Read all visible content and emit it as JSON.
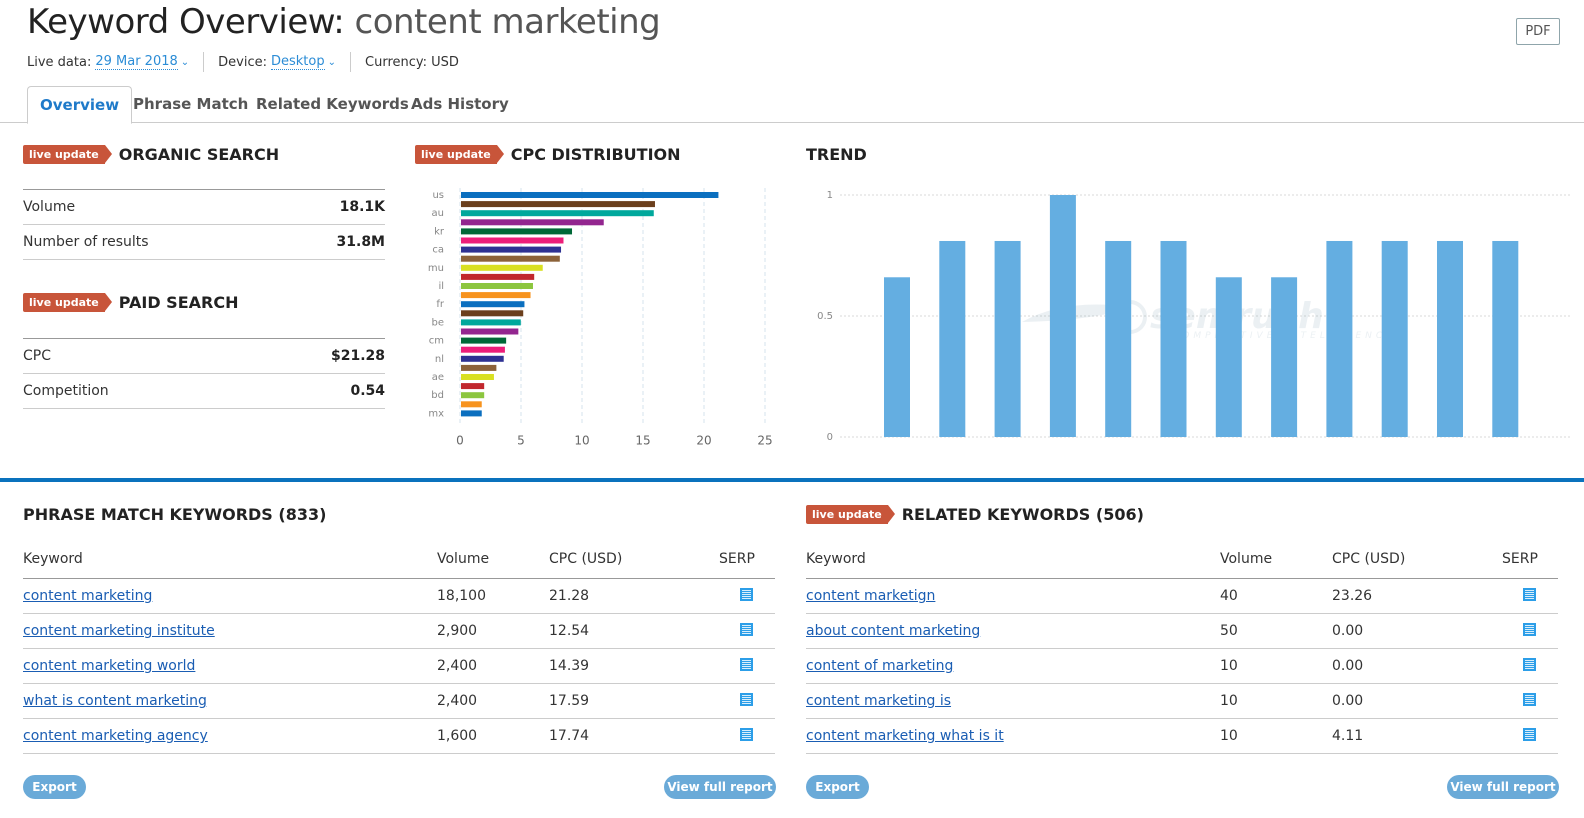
{
  "header": {
    "title_prefix": "Keyword Overview:",
    "keyword": "content marketing",
    "pdf_label": "PDF",
    "meta": {
      "live_data_label": "Live data:",
      "live_data_value": "29 Mar 2018",
      "device_label": "Device:",
      "device_value": "Desktop",
      "currency": "Currency: USD"
    }
  },
  "tabs": [
    {
      "label": "Overview",
      "active": true
    },
    {
      "label": "Phrase Match",
      "active": false
    },
    {
      "label": "Related Keywords",
      "active": false
    },
    {
      "label": "Ads History",
      "active": false
    }
  ],
  "badge_label": "live update",
  "organic": {
    "title": "ORGANIC SEARCH",
    "rows": [
      {
        "label": "Volume",
        "value": "18.1K"
      },
      {
        "label": "Number of results",
        "value": "31.8M"
      }
    ]
  },
  "paid": {
    "title": "PAID SEARCH",
    "rows": [
      {
        "label": "CPC",
        "value": "$21.28"
      },
      {
        "label": "Competition",
        "value": "0.54"
      }
    ]
  },
  "colors": {
    "accent_blue": "#0a72bd",
    "badge_red": "#c8553a",
    "trend_bar": "#64aee1",
    "button_blue": "#6aaad8",
    "link": "#1a5db3"
  },
  "chart_data": [
    {
      "type": "bar",
      "orientation": "horizontal",
      "title": "CPC DISTRIBUTION",
      "categories": [
        "us",
        "",
        "au",
        "",
        "kr",
        "",
        "ca",
        "",
        "mu",
        "",
        "il",
        "",
        "fr",
        "",
        "be",
        "",
        "cm",
        "",
        "nl",
        "",
        "ae",
        "",
        "bd",
        "",
        "mx"
      ],
      "tick_labels": [
        "us",
        "au",
        "kr",
        "ca",
        "mu",
        "il",
        "fr",
        "be",
        "cm",
        "nl",
        "ae",
        "bd",
        "mx"
      ],
      "values": [
        21.1,
        15.9,
        15.8,
        11.7,
        9.1,
        8.4,
        8.2,
        8.1,
        6.7,
        6.0,
        5.9,
        5.7,
        5.2,
        5.1,
        4.9,
        4.7,
        3.7,
        3.6,
        3.5,
        2.9,
        2.7,
        1.9,
        1.9,
        1.7,
        1.7
      ],
      "bar_colors": [
        "#0b6fbf",
        "#6b3f1c",
        "#00a89c",
        "#93268f",
        "#006837",
        "#ed1e79",
        "#2e3192",
        "#8c6239",
        "#d9e021",
        "#c1272d",
        "#8cc63f",
        "#f7931e"
      ],
      "xlim": [
        0,
        25
      ],
      "x_ticks": [
        0,
        5,
        10,
        15,
        20,
        25
      ],
      "grid": true
    },
    {
      "type": "bar",
      "title": "TREND",
      "categories": [
        "1",
        "2",
        "3",
        "4",
        "5",
        "6",
        "7",
        "8",
        "9",
        "10",
        "11",
        "12"
      ],
      "values": [
        0.66,
        0.81,
        0.81,
        1.0,
        0.81,
        0.81,
        0.66,
        0.66,
        0.81,
        0.81,
        0.81,
        0.81
      ],
      "ylim": [
        0,
        1
      ],
      "y_ticks": [
        0,
        0.5,
        1
      ],
      "y_tick_labels": [
        "0",
        "0.5",
        "1"
      ],
      "grid": true,
      "watermark": {
        "brand": "semrush",
        "tagline": "COMPETITIVE INTELLIGENCE"
      }
    }
  ],
  "phrase_match": {
    "title": "PHRASE MATCH KEYWORDS (833)",
    "columns": [
      "Keyword",
      "Volume",
      "CPC (USD)",
      "SERP"
    ],
    "rows": [
      {
        "keyword": "content marketing",
        "volume": "18,100",
        "cpc": "21.28"
      },
      {
        "keyword": "content marketing institute",
        "volume": "2,900",
        "cpc": "12.54"
      },
      {
        "keyword": "content marketing world",
        "volume": "2,400",
        "cpc": "14.39"
      },
      {
        "keyword": "what is content marketing",
        "volume": "2,400",
        "cpc": "17.59"
      },
      {
        "keyword": "content marketing agency",
        "volume": "1,600",
        "cpc": "17.74"
      }
    ],
    "export_label": "Export",
    "full_report_label": "View full report"
  },
  "related": {
    "title": "RELATED KEYWORDS (506)",
    "columns": [
      "Keyword",
      "Volume",
      "CPC (USD)",
      "SERP"
    ],
    "rows": [
      {
        "keyword": "content marketign",
        "volume": "40",
        "cpc": "23.26"
      },
      {
        "keyword": "about content marketing",
        "volume": "50",
        "cpc": "0.00"
      },
      {
        "keyword": "content of marketing",
        "volume": "10",
        "cpc": "0.00"
      },
      {
        "keyword": "content marketing is",
        "volume": "10",
        "cpc": "0.00"
      },
      {
        "keyword": "content marketing what is it",
        "volume": "10",
        "cpc": "4.11"
      }
    ],
    "export_label": "Export",
    "full_report_label": "View full report"
  }
}
